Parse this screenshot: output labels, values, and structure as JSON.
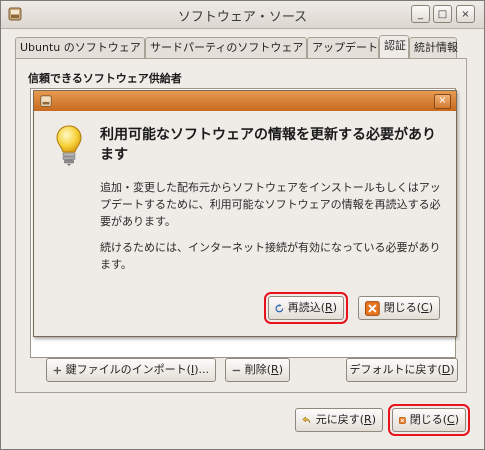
{
  "window": {
    "title": "ソフトウェア・ソース",
    "controls": {
      "minimize": "_",
      "maximize": "□",
      "close": "×"
    }
  },
  "tabs": [
    {
      "label": "Ubuntu のソフトウェア"
    },
    {
      "label": "サードパーティのソフトウェア"
    },
    {
      "label": "アップデート"
    },
    {
      "label": "認証",
      "active": true
    },
    {
      "label": "統計情報"
    }
  ],
  "auth": {
    "section_title": "信頼できるソフトウェア供給者",
    "import_key_label": "鍵ファイルのインポート(",
    "import_key_mnemonic": "I",
    "import_key_suffix": ")...",
    "delete_label": "削除(",
    "delete_mnemonic": "R",
    "delete_suffix": ")",
    "restore_defaults_label": "デフォルトに戻す(",
    "restore_defaults_mnemonic": "D",
    "restore_defaults_suffix": ")"
  },
  "footer": {
    "revert_label": "元に戻す(",
    "revert_mnemonic": "R",
    "revert_suffix": ")",
    "close_label": "閉じる(",
    "close_mnemonic": "C",
    "close_suffix": ")"
  },
  "dialog": {
    "close_glyph": "×",
    "heading": "利用可能なソフトウェアの情報を更新する必要があります",
    "body1": "追加・変更した配布元からソフトウェアをインストールもしくはアップデートするために、利用可能なソフトウェアの情報を再読込する必要があります。",
    "body2": "続けるためには、インターネット接続が有効になっている必要があります。",
    "reload_label": "再読込(",
    "reload_mnemonic": "R",
    "reload_suffix": ")",
    "close_label": "閉じる(",
    "close_mnemonic": "C",
    "close_suffix": ")"
  },
  "colors": {
    "highlight": "#e8121d",
    "dialog_titlebar": "#d67a2e",
    "window_bg": "#efebe7"
  },
  "icons": {
    "app": "software-sources-icon",
    "lightbulb": "lightbulb-icon",
    "reload": "reload-icon",
    "close": "close-x-icon",
    "add": "plus-icon",
    "remove": "minus-icon",
    "revert": "revert-icon"
  }
}
